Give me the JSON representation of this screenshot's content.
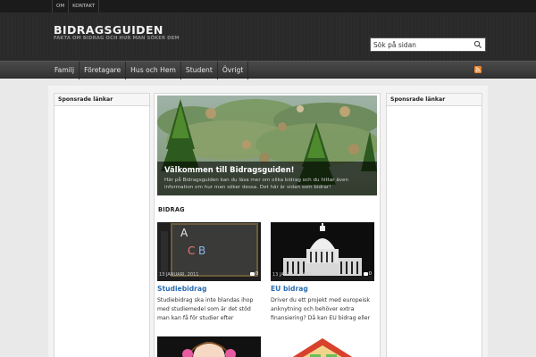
{
  "topnav": [
    "OM",
    "KONTAKT"
  ],
  "header": {
    "title": "BIDRAGSGUIDEN",
    "tagline": "FAKTA OM BIDRAG OCH HUR MAN SÖKER DEM",
    "search_value": "Sök på sidan"
  },
  "mainnav": [
    "Familj",
    "Företagare",
    "Hus och Hem",
    "Student",
    "Övrigt"
  ],
  "sidebar_left": {
    "title": "Sponsrade länkar"
  },
  "sidebar_right": {
    "title": "Sponsrade länkar"
  },
  "featured": {
    "title": "Välkommen till Bidragsguiden!",
    "text": [
      "Här på Bidragsguiden kan du läsa mer om olika bidrag och du hittar även",
      "information om hur man söker dessa. Det här är sidan som bidrar!"
    ]
  },
  "section_title": "BIDRAG",
  "posts": [
    {
      "date": "13 JANUARI, 2011",
      "comments": "0",
      "title": "Studiebidrag",
      "excerpt": [
        "Studiebidrag ska inte blandas ihop",
        "med studiemedel som är det stöd",
        "man kan få för studier efter"
      ],
      "thumb": {
        "letters": [
          "A",
          "B",
          "C"
        ]
      }
    },
    {
      "date": "13 JANUARI, 2011",
      "comments": "0",
      "title": "EU bidrag",
      "excerpt": [
        "Driver du ett projekt med europeisk",
        "anknytning och behöver extra",
        "finansiering? Då kan EU bidrag eller"
      ]
    }
  ]
}
